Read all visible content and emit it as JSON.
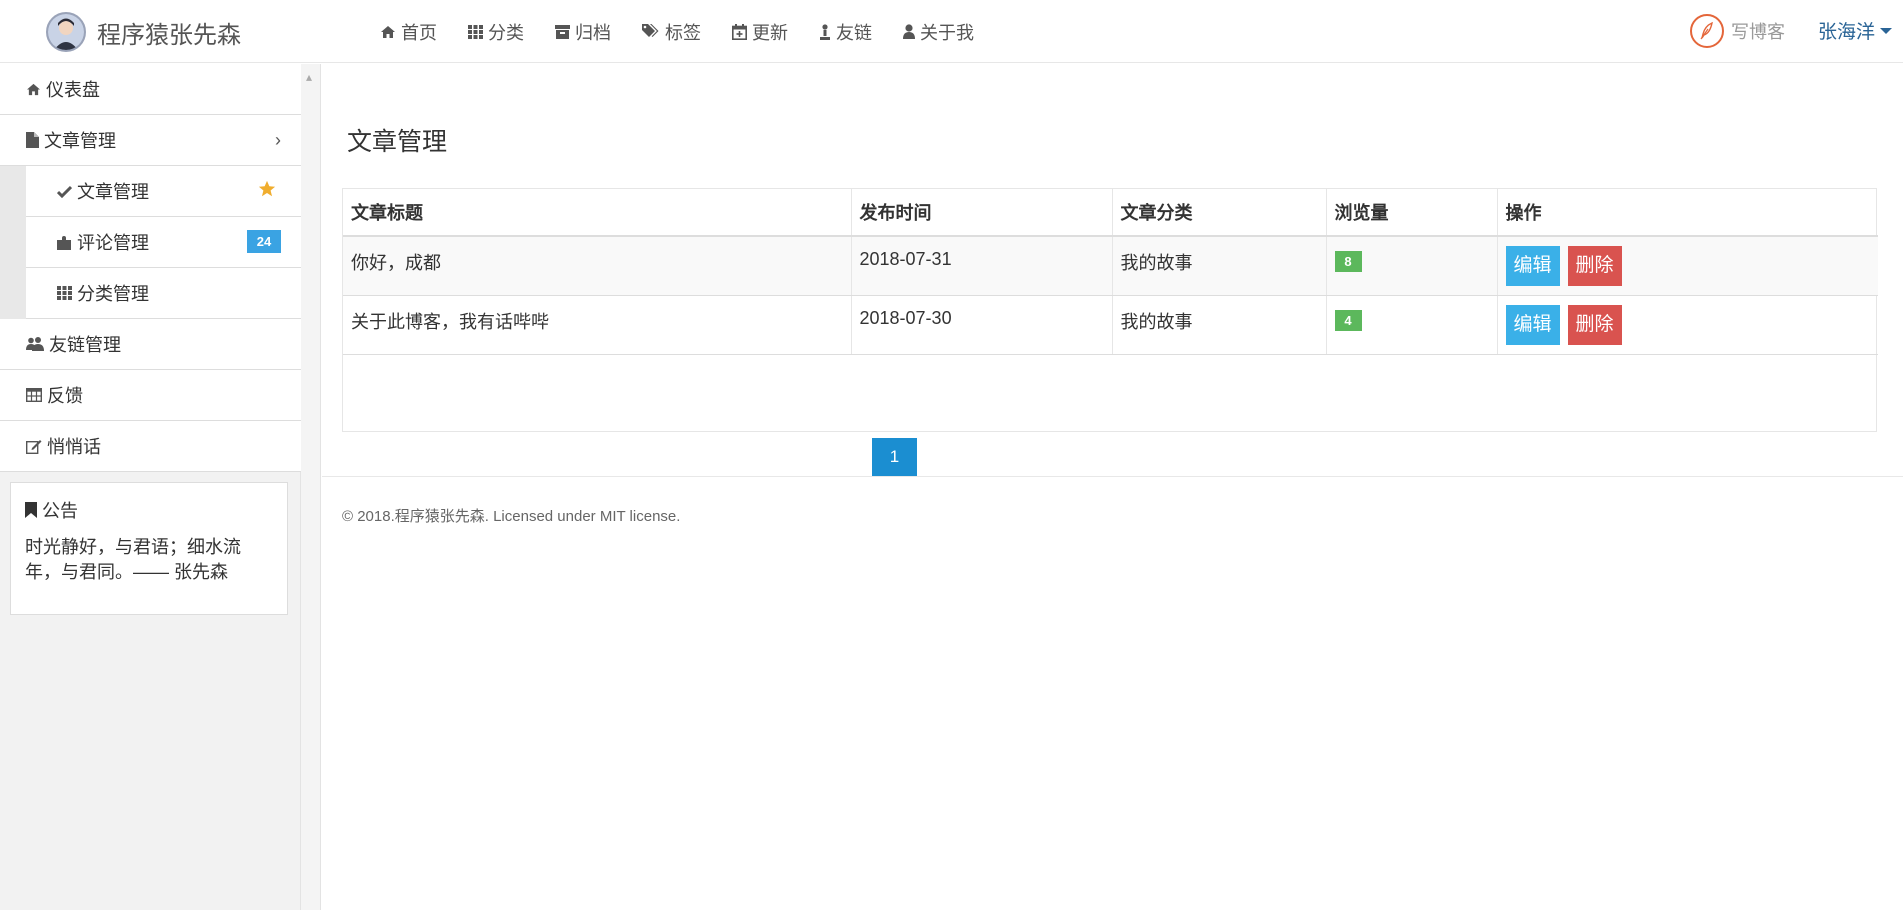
{
  "header": {
    "brand_name": "程序猿张先森",
    "nav": [
      {
        "label": "首页",
        "icon": "home-icon"
      },
      {
        "label": "分类",
        "icon": "grid-icon"
      },
      {
        "label": "归档",
        "icon": "archive-icon"
      },
      {
        "label": "标签",
        "icon": "tags-icon"
      },
      {
        "label": "更新",
        "icon": "calendar-plus-icon"
      },
      {
        "label": "友链",
        "icon": "link-person-icon"
      },
      {
        "label": "关于我",
        "icon": "user-icon"
      }
    ],
    "write_label": "写博客",
    "user_name": "张海洋"
  },
  "sidebar": {
    "items": [
      {
        "label": "仪表盘",
        "icon": "home-icon"
      },
      {
        "label": "文章管理",
        "icon": "file-icon"
      },
      {
        "label": "友链管理",
        "icon": "users-icon"
      },
      {
        "label": "反馈",
        "icon": "table-icon"
      },
      {
        "label": "悄悄话",
        "icon": "edit-icon"
      }
    ],
    "sub_items": [
      {
        "label": "文章管理",
        "icon": "check-icon"
      },
      {
        "label": "评论管理",
        "icon": "puzzle-icon",
        "badge": "24"
      },
      {
        "label": "分类管理",
        "icon": "grid-icon"
      }
    ],
    "notice": {
      "title": "公告",
      "text": "时光静好，与君语；细水流年，与君同。—— 张先森"
    }
  },
  "main": {
    "title": "文章管理",
    "columns": [
      "文章标题",
      "发布时间",
      "文章分类",
      "浏览量",
      "操作"
    ],
    "rows": [
      {
        "title": "你好，成都",
        "date": "2018-07-31",
        "category": "我的故事",
        "views": "8"
      },
      {
        "title": "关于此博客，我有话哔哔",
        "date": "2018-07-30",
        "category": "我的故事",
        "views": "4"
      }
    ],
    "edit_label": "编辑",
    "delete_label": "删除",
    "page": "1",
    "footer": "© 2018.程序猿张先森. Licensed under MIT license."
  },
  "colors": {
    "primary": "#3ab0e8",
    "danger": "#d9534f",
    "success": "#5cb85c",
    "pager": "#1b8ed1",
    "badge": "#3aa3e3",
    "star": "#f0ad2e"
  }
}
